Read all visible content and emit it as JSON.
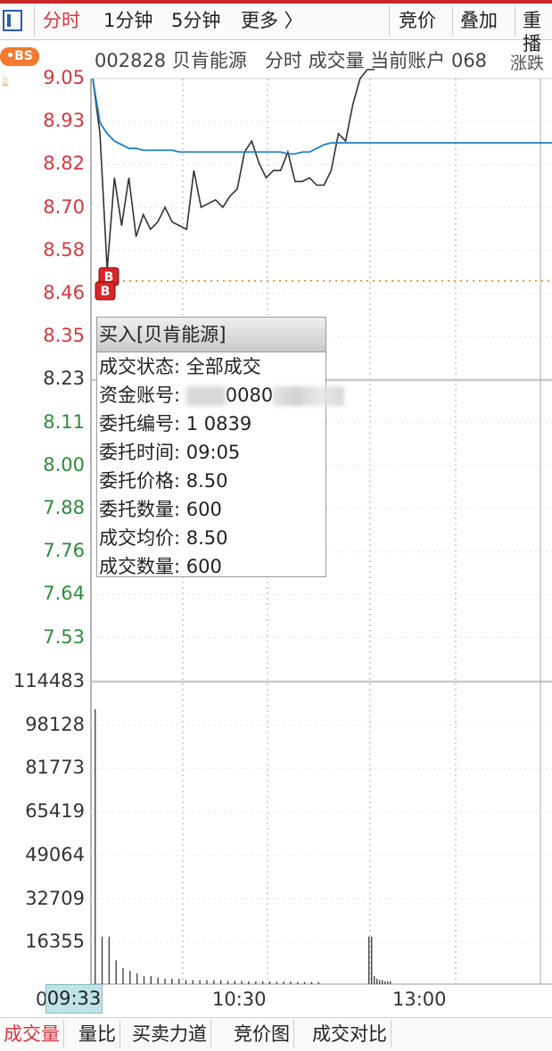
{
  "toolbar": {
    "tabs": [
      "分时",
      "1分钟",
      "5分钟",
      "更多 〉"
    ],
    "right_tabs": [
      "竞价",
      "叠加",
      "重播"
    ],
    "active_color": "#d9363e"
  },
  "header": {
    "code": "002828",
    "name": "贝肯能源",
    "chart_mode": "分时",
    "indicator": "成交量",
    "account_label": "当前账户",
    "account_prefix": "068",
    "overlap_label": "涨跌",
    "bs_badge": "•BS"
  },
  "price_axis": {
    "labels": [
      "9.05",
      "8.93",
      "8.82",
      "8.70",
      "8.58",
      "8.46",
      "8.35",
      "8.23",
      "8.11",
      "8.00",
      "7.88",
      "7.76",
      "7.64",
      "7.53"
    ],
    "colors": [
      "red",
      "red",
      "red",
      "red",
      "red",
      "red",
      "red",
      "gray",
      "green",
      "green",
      "green",
      "green",
      "green",
      "green"
    ]
  },
  "volume_axis": {
    "labels": [
      "114483",
      "98128",
      "81773",
      "65419",
      "49064",
      "32709",
      "16355"
    ]
  },
  "tooltip": {
    "title": "买入[贝肯能源]",
    "rows": [
      {
        "label": "成交状态:",
        "value": "全部成交"
      },
      {
        "label": "资金账号:",
        "value": "0080"
      },
      {
        "label": "委托编号:",
        "value": "1  0839"
      },
      {
        "label": "委托时间:",
        "value": "09:05"
      },
      {
        "label": "委托价格:",
        "value": "8.50"
      },
      {
        "label": "委托数量:",
        "value": "600"
      },
      {
        "label": "成交均价:",
        "value": "8.50"
      },
      {
        "label": "成交数量:",
        "value": "600"
      }
    ]
  },
  "time_axis": {
    "cursor": "09:33",
    "labels": [
      "10:30",
      "13:00"
    ],
    "first_label_stub": "0"
  },
  "trade_marker": "B",
  "bottom_tabs": [
    "成交量",
    "量比",
    "买卖力道",
    "竞价图",
    "成交对比"
  ],
  "chart_data": {
    "type": "line",
    "series": [
      {
        "values": [
          9.05,
          8.9,
          8.53,
          8.78,
          8.65,
          8.78,
          8.62,
          8.68,
          8.64,
          8.66,
          8.7,
          8.66,
          8.65,
          8.64,
          8.8,
          8.7,
          8.71,
          8.72,
          8.7,
          8.73,
          8.75,
          8.85,
          8.88,
          8.82,
          8.78,
          8.8,
          8.8,
          8.85,
          8.77,
          8.77,
          8.78,
          8.76,
          8.76,
          8.8,
          8.9,
          8.88,
          8.98,
          9.05,
          9.08,
          9.1
        ]
      },
      {
        "values": [
          9.05,
          8.93,
          8.9,
          8.88,
          8.87,
          8.86,
          8.86,
          8.855,
          8.855,
          8.855,
          8.855,
          8.855,
          8.85,
          8.85,
          8.85,
          8.85,
          8.85,
          8.85,
          8.85,
          8.85,
          8.85,
          8.85,
          8.85,
          8.85,
          8.85,
          8.85,
          8.85,
          8.845,
          8.845,
          8.85,
          8.85,
          8.86,
          8.87,
          8.875,
          8.875,
          8.875,
          8.875,
          8.875,
          8.875,
          8.875
        ]
      }
    ],
    "ylim": [
      7.53,
      9.05
    ],
    "volume": [
      104000,
      18000,
      18000,
      9000,
      6000,
      5000,
      4000,
      3000,
      3000,
      2500,
      2000,
      2000,
      2000,
      1500,
      1500,
      1500,
      1500,
      1500,
      1500,
      1200,
      1200,
      1200,
      1000,
      1000,
      1000,
      1000,
      900,
      900,
      900,
      800,
      800,
      800,
      800,
      18000,
      18000,
      3000,
      2000,
      1500,
      1500,
      1000,
      1000,
      1000
    ]
  }
}
